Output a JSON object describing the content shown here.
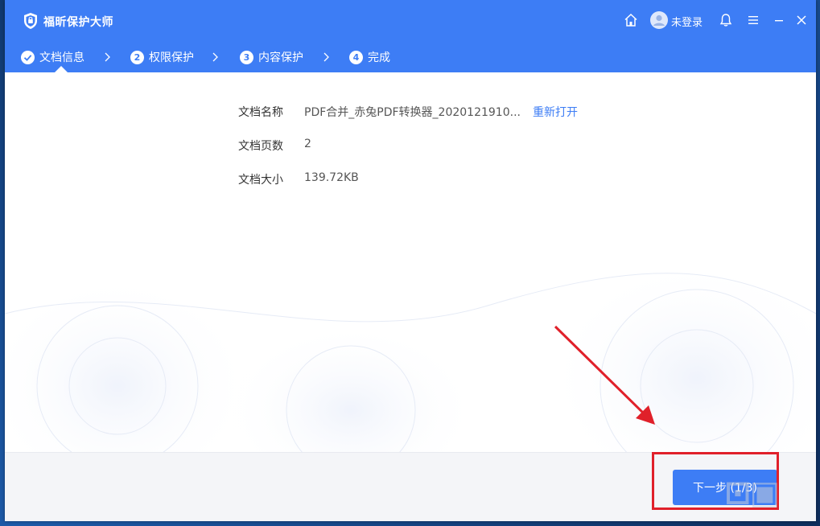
{
  "app": {
    "title": "福昕保护大师"
  },
  "header": {
    "login_label": "未登录"
  },
  "steps": [
    {
      "label": "文档信息",
      "number": "1",
      "state": "done"
    },
    {
      "label": "权限保护",
      "number": "2",
      "state": "pending"
    },
    {
      "label": "内容保护",
      "number": "3",
      "state": "pending"
    },
    {
      "label": "完成",
      "number": "4",
      "state": "pending"
    }
  ],
  "document": {
    "name_label": "文档名称",
    "name_value": "PDF合并_赤兔PDF转换器_2020121910...",
    "reopen_label": "重新打开",
    "pages_label": "文档页数",
    "pages_value": "2",
    "size_label": "文档大小",
    "size_value": "139.72KB"
  },
  "footer": {
    "next_label": "下一步 (1/3)"
  },
  "colors": {
    "accent": "#3d7df5",
    "annotation": "#e0202a"
  }
}
